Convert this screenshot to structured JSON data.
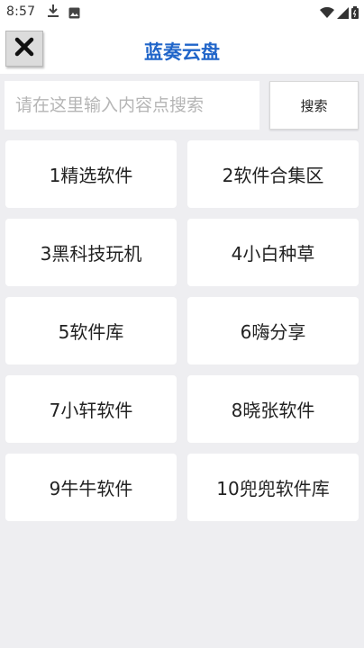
{
  "status_bar": {
    "time": "8:57",
    "icons": [
      "download-icon",
      "photo-icon",
      "wifi-icon",
      "signal-icon",
      "battery-icon"
    ]
  },
  "header": {
    "title": "蓝奏云盘",
    "close_icon": "close-icon",
    "title_color": "#2065c9"
  },
  "search": {
    "placeholder": "请在这里输入内容点搜索",
    "value": "",
    "button_label": "搜索"
  },
  "tiles": [
    {
      "label": "1精选软件"
    },
    {
      "label": "2软件合集区"
    },
    {
      "label": "3黑科技玩机"
    },
    {
      "label": "4小白种草"
    },
    {
      "label": "5软件库"
    },
    {
      "label": "6嗨分享"
    },
    {
      "label": "7小轩软件"
    },
    {
      "label": "8晓张软件"
    },
    {
      "label": "9牛牛软件"
    },
    {
      "label": "10兜兜软件库"
    }
  ]
}
